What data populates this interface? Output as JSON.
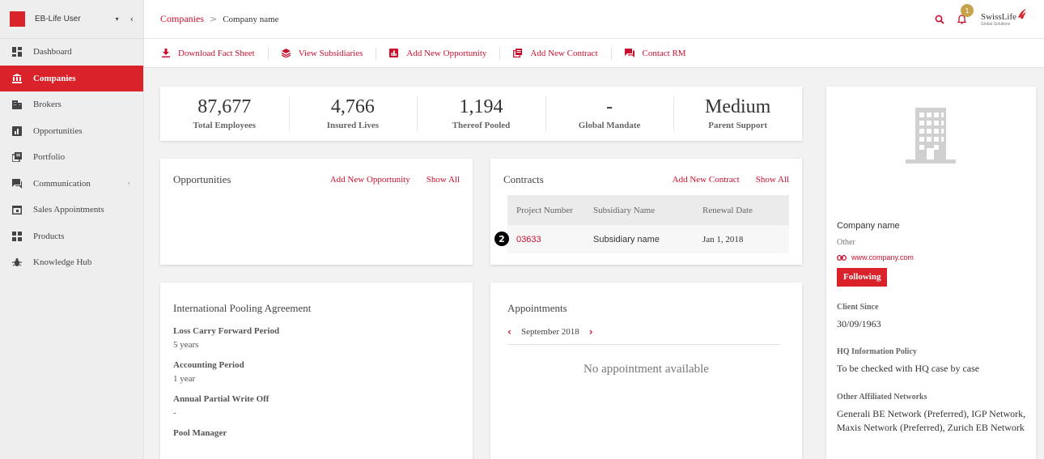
{
  "sidebar": {
    "user_name": "EB-Life User",
    "items": [
      {
        "label": "Dashboard",
        "icon": "dashboard-icon"
      },
      {
        "label": "Companies",
        "icon": "bank-icon",
        "active": true
      },
      {
        "label": "Brokers",
        "icon": "building-icon"
      },
      {
        "label": "Opportunities",
        "icon": "opportunities-icon"
      },
      {
        "label": "Portfolio",
        "icon": "portfolio-icon"
      },
      {
        "label": "Communication",
        "icon": "chat-icon",
        "has_submenu": true
      },
      {
        "label": "Sales Appointments",
        "icon": "calendar-icon"
      },
      {
        "label": "Products",
        "icon": "products-icon"
      },
      {
        "label": "Knowledge Hub",
        "icon": "bug-icon"
      }
    ]
  },
  "header": {
    "breadcrumb_root": "Companies",
    "breadcrumb_separator": ">",
    "breadcrumb_current": "Company name",
    "notification_count": "1",
    "logo_text": "SwissLife",
    "logo_subtext": "Global Solutions"
  },
  "actions": {
    "download": "Download Fact Sheet",
    "subsidiaries": "View Subsidiaries",
    "add_opportunity": "Add New Opportunity",
    "add_contract": "Add New Contract",
    "contact_rm": "Contact RM"
  },
  "stats": [
    {
      "value": "87,677",
      "label": "Total Employees"
    },
    {
      "value": "4,766",
      "label": "Insured Lives"
    },
    {
      "value": "1,194",
      "label": "Thereof Pooled"
    },
    {
      "value": "-",
      "label": "Global Mandate"
    },
    {
      "value": "Medium",
      "label": "Parent Support"
    }
  ],
  "opportunities": {
    "title": "Opportunities",
    "add_link": "Add New Opportunity",
    "show_all": "Show All"
  },
  "contracts": {
    "title": "Contracts",
    "add_link": "Add New Contract",
    "show_all": "Show All",
    "columns": [
      "Project Number",
      "Subsidiary Name",
      "Renewal Date"
    ],
    "rows": [
      {
        "project": "03633",
        "subsidiary": "Subsidiary name",
        "renewal": "Jan 1, 2018"
      }
    ],
    "marker": "2"
  },
  "igp": {
    "title": "International Pooling Agreement",
    "fields": [
      {
        "label": "Loss Carry Forward Period",
        "value": "5 years"
      },
      {
        "label": "Accounting Period",
        "value": "1 year"
      },
      {
        "label": "Annual Partial Write Off",
        "value": "-"
      },
      {
        "label": "Pool Manager",
        "value": ""
      }
    ]
  },
  "appointments": {
    "title": "Appointments",
    "month": "September 2018",
    "empty_text": "No appointment available"
  },
  "company": {
    "name": "Company name",
    "type": "Other",
    "url": "www.company.com",
    "follow_label": "Following",
    "client_since_label": "Client Since",
    "client_since": "30/09/1963",
    "hq_policy_label": "HQ Information Policy",
    "hq_policy": "To be checked with HQ case by case",
    "networks_label": "Other Affiliated Networks",
    "networks": "Generali BE Network (Preferred), IGP Network, Maxis Network (Preferred), Zurich EB Network"
  },
  "colors": {
    "brand_red": "#d9222a",
    "link_red": "#c8102e",
    "badge_gold": "#c6a24a",
    "sidebar_bg": "#eeeeee"
  }
}
